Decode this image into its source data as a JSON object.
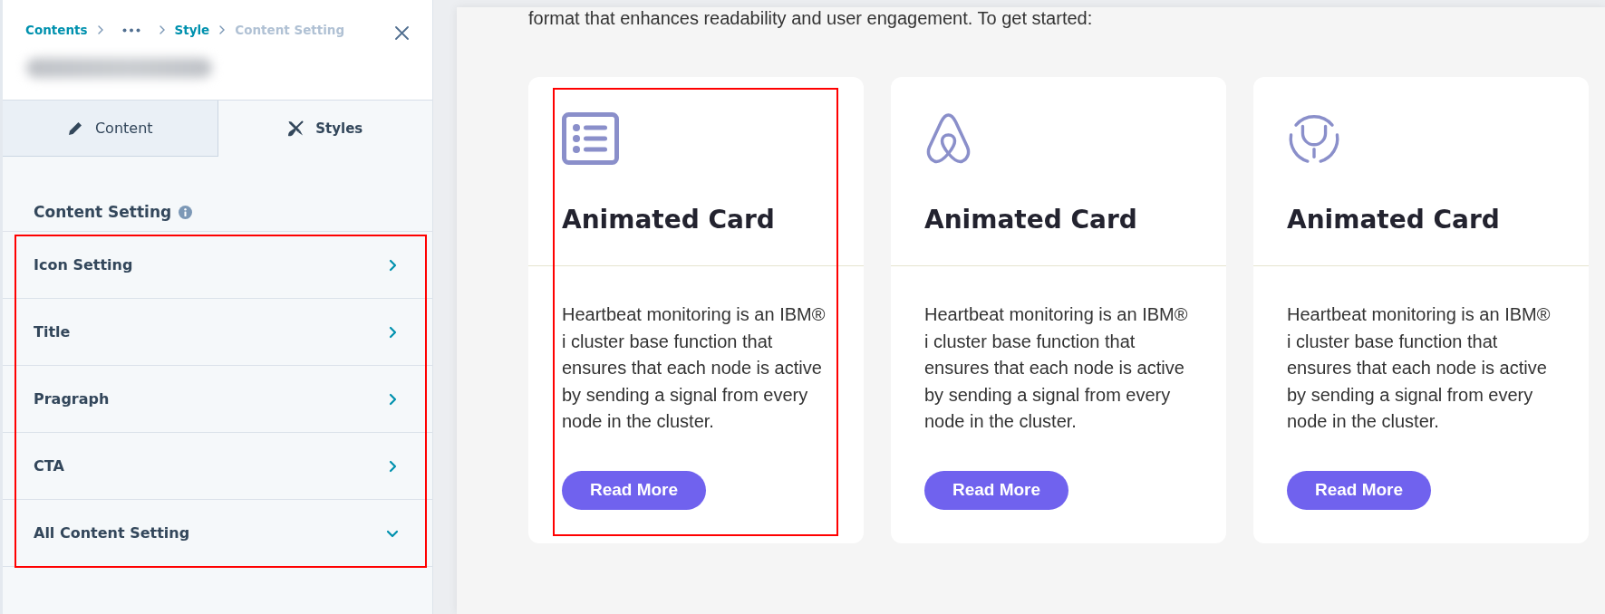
{
  "breadcrumb": [
    {
      "kind": "link",
      "label": "Contents"
    },
    {
      "kind": "more"
    },
    {
      "kind": "link",
      "label": "Style"
    },
    {
      "kind": "current",
      "label": "Content Setting"
    }
  ],
  "tabs": [
    {
      "kind": "pencil",
      "label": "Content",
      "selected": false
    },
    {
      "kind": "tools",
      "label": "Styles",
      "selected": true
    }
  ],
  "section": {
    "title": "Content Setting",
    "highlighted": true,
    "items": [
      {
        "label": "Icon Setting",
        "expanded": false
      },
      {
        "label": "Title",
        "expanded": false
      },
      {
        "label": "Pragraph",
        "expanded": false
      },
      {
        "label": "CTA",
        "expanded": false
      },
      {
        "label": "All Content Setting",
        "expanded": true
      }
    ]
  },
  "preview": {
    "intro": "format that enhances readability and user engagement. To get started:",
    "cards": [
      {
        "kind": "list",
        "title": "Animated Card",
        "text": "Heartbeat monitoring is an IBM® i cluster base function that ensures that each node is active by sending a signal from every node in the cluster.",
        "button": "Read More",
        "highlighted": true
      },
      {
        "kind": "loop",
        "title": "Animated Card",
        "text": "Heartbeat monitoring is an IBM® i cluster base function that ensures that each node is active by sending a signal from every node in the cluster.",
        "button": "Read More",
        "highlighted": false
      },
      {
        "kind": "fork",
        "title": "Animated Card",
        "text": "Heartbeat monitoring is an IBM® i cluster base function that ensures that each node is active by sending a signal from every node in the cluster.",
        "button": "Read More",
        "highlighted": false
      }
    ]
  }
}
